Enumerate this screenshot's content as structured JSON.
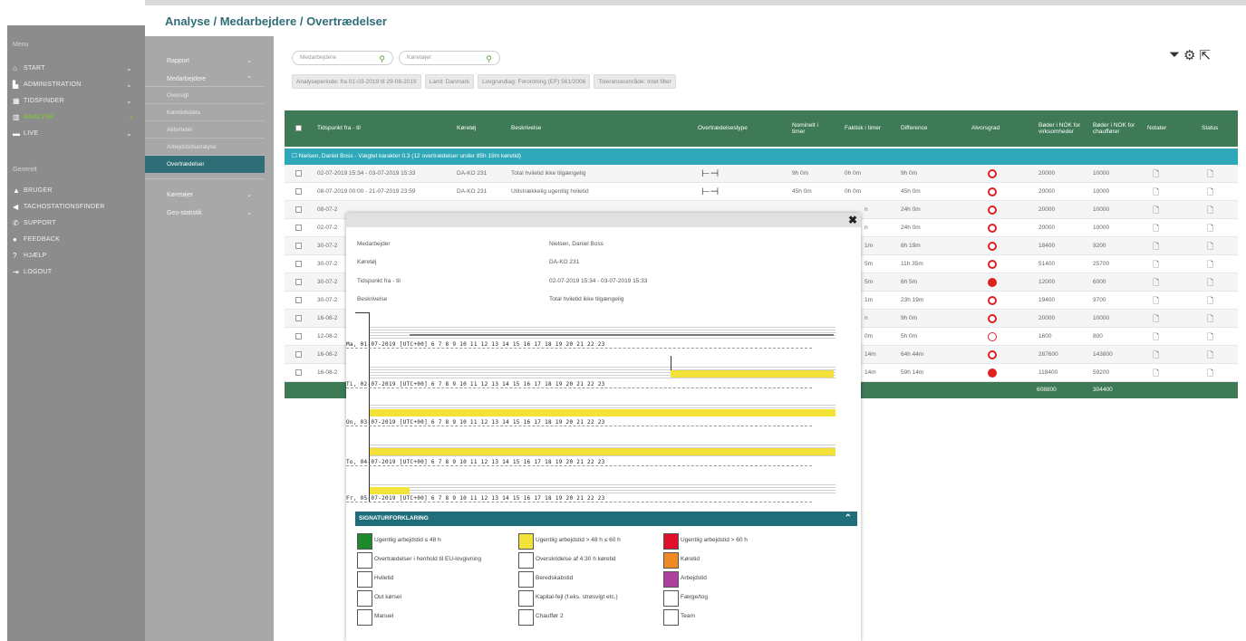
{
  "header": {
    "breadcrumb": "Analyse / Medarbejdere / Overtrædelser"
  },
  "mainmenu": {
    "title": "Menu",
    "items": [
      "START",
      "ADMINISTRATION",
      "TIDSFINDER",
      "ANALYSE",
      "LIVE"
    ],
    "group": "Generelt",
    "general": [
      "BRUGER",
      "TACHOSTATIONSFINDER",
      "SUPPORT",
      "FEEDBACK",
      "HJÆLP",
      "LOGOUT"
    ]
  },
  "submenu": {
    "rapport": "Rapport",
    "medarbejdere": "Medarbejdere",
    "subs": [
      "Oversigt",
      "Køretidsdata",
      "Aktiviteter",
      "Arbejdstidsanalyse",
      "Overtrædelser"
    ],
    "koeretoejer": "Køretøjer",
    "geostatistik": "Geo-statistik"
  },
  "filters": {
    "medarbejdere_placeholder": "Medarbejdere",
    "koeretoejer_placeholder": "Køretøjer",
    "chips": [
      "Analyseperiode: fra 01-03-2019 til 29-08-2019",
      "Land: Danmark",
      "Lovgrundlag: Forordning (EF) 561/2006",
      "Toleranceområde: Intet filter"
    ]
  },
  "table": {
    "headers": {
      "time": "Tidspunkt fra - til",
      "vehicle": "Køretøj",
      "desc": "Beskrivelse",
      "type": "Overtrædelsestype",
      "nominal": "Nominelt i timer",
      "actual": "Faktisk i timer",
      "diff": "Difference",
      "severity": "Alvorsgrad",
      "fine_company": "Bøder i NOK for virksomheder",
      "fine_driver": "Bøder i NOK for chauffører",
      "notes": "Notater",
      "status": "Status"
    },
    "group": "Nielsen, Daniel Boss - Vægtet karakter 0.3 (12 overtrædelser under 85h 19m køretid)",
    "rows": [
      {
        "time": "02-07-2019 15:34 - 03-07-2019 15:33",
        "vehicle": "DA-KO 231",
        "desc": "Total hviletid ikke tilgængelig",
        "nominal": "9h 0m",
        "actual": "0h 0m",
        "diff": "9h 0m",
        "sev": "ring",
        "fc": "20000",
        "fd": "10000"
      },
      {
        "time": "08-07-2019 00:00 - 21-07-2019 23:59",
        "vehicle": "DA-KO 231",
        "desc": "Utilstrækkelig ugentlig hviletid",
        "nominal": "45h 0m",
        "actual": "0h 0m",
        "diff": "45h 0m",
        "sev": "ring",
        "fc": "20000",
        "fd": "10000"
      },
      {
        "time": "08-07-2",
        "actual": "n",
        "diff": "24h 0m",
        "sev": "ring",
        "fc": "20000",
        "fd": "10000"
      },
      {
        "time": "02-07-2",
        "actual": "n",
        "diff": "24h 0m",
        "sev": "ring",
        "fc": "20000",
        "fd": "10000"
      },
      {
        "time": "30-07-2",
        "actual": "1m",
        "diff": "8h 19m",
        "sev": "ring",
        "fc": "18400",
        "fd": "9200"
      },
      {
        "time": "30-07-2",
        "actual": "5m",
        "diff": "11h 35m",
        "sev": "ring",
        "fc": "51400",
        "fd": "25700"
      },
      {
        "time": "30-07-2",
        "actual": "5m",
        "diff": "6h 5m",
        "sev": "dot",
        "fc": "12000",
        "fd": "6000"
      },
      {
        "time": "30-07-2",
        "actual": "1m",
        "diff": "23h 19m",
        "sev": "ring",
        "fc": "19400",
        "fd": "9700"
      },
      {
        "time": "16-08-2",
        "actual": "n",
        "diff": "9h 0m",
        "sev": "ring",
        "fc": "20000",
        "fd": "10000"
      },
      {
        "time": "12-08-2",
        "actual": "0m",
        "diff": "5h 0m",
        "sev": "thin",
        "fc": "1600",
        "fd": "800"
      },
      {
        "time": "16-08-2",
        "actual": "14m",
        "diff": "64h 44m",
        "sev": "ring",
        "fc": "287600",
        "fd": "143800"
      },
      {
        "time": "16-08-2",
        "actual": "14m",
        "diff": "59h 14m",
        "sev": "dot",
        "fc": "118400",
        "fd": "59200"
      }
    ],
    "totals": {
      "fc": "608800",
      "fd": "304400"
    }
  },
  "modal": {
    "fields": [
      {
        "label": "Medarbejder",
        "value": "Nielsen, Daniel Boss"
      },
      {
        "label": "Køretøj",
        "value": "DA-KO 231"
      },
      {
        "label": "Tidspunkt fra - til",
        "value": "02-07-2019 15:34 - 03-07-2019 15:33"
      },
      {
        "label": "Beskrivelse",
        "value": "Total hviletid ikke tilgængelig"
      }
    ],
    "rulers": [
      "Ma, 01-07-2019 [UTC+00]   6    7    8    9   10   11   12   13   14   15   16   17   18   19   20   21   22   23",
      "Ti, 02-07-2019 [UTC+00]   6    7    8    9   10   11   12   13   14   15   16   17   18   19   20   21   22   23",
      "On, 03-07-2019 [UTC+00]   6    7    8    9   10   11   12   13   14   15   16   17   18   19   20   21   22   23",
      "To, 04-07-2019 [UTC+00]   6    7    8    9   10   11   12   13   14   15   16   17   18   19   20   21   22   23",
      "Fr, 05-07-2019 [UTC+00]   6    7    8    9   10   11   12   13   14   15   16   17   18   19   20   21   22   23"
    ],
    "legend_title": "SIGNATURFORKLARING",
    "legend": [
      {
        "label": "Ugentlig arbejdstid ≤ 48 h",
        "color": "#1e8a2e"
      },
      {
        "label": "Ugentlig arbejdstid > 48 h ≤ 60 h",
        "color": "#f3e23a"
      },
      {
        "label": "Ugentlig arbejdstid > 60 h",
        "color": "#e0102a"
      },
      {
        "label": "Overtrædelser i henhold til EU-lovgivning",
        "color": "#ffffff"
      },
      {
        "label": "Overskridelse af 4:30 h køretid",
        "color": "#ffffff"
      },
      {
        "label": "Køretid",
        "color": "#f08a24"
      },
      {
        "label": "Hviletid",
        "color": "#ffffff"
      },
      {
        "label": "Beredskabstid",
        "color": "#ffffff"
      },
      {
        "label": "Arbejdstid",
        "color": "#b040a0"
      },
      {
        "label": "Out kørsel",
        "color": "#ffffff"
      },
      {
        "label": "Kapital-fejl (f.eks. strøsvigt etc.)",
        "color": "#ffffff"
      },
      {
        "label": "Færge/tog",
        "color": "#ffffff"
      },
      {
        "label": "Manuel",
        "color": "#ffffff"
      },
      {
        "label": "Chauffør 2",
        "color": "#ffffff"
      },
      {
        "label": "Team",
        "color": "#ffffff"
      }
    ]
  }
}
